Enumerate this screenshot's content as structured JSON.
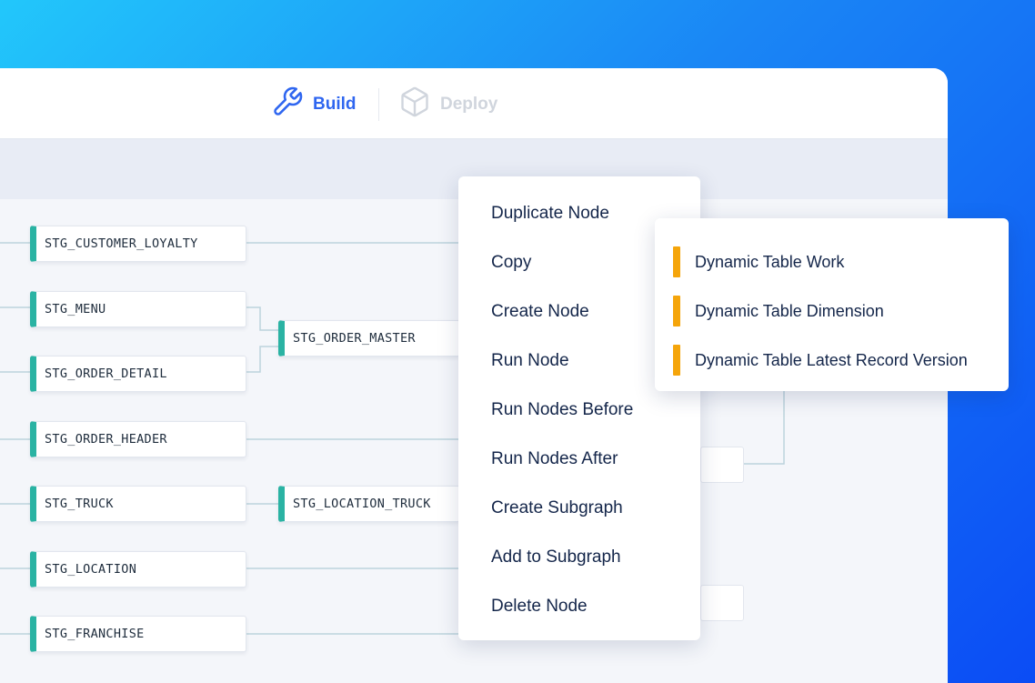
{
  "tabs": {
    "build": {
      "label": "Build",
      "icon": "wrench-icon",
      "color": "#2f66f0"
    },
    "deploy": {
      "label": "Deploy",
      "icon": "cube-icon",
      "color": "#d0d5dd"
    }
  },
  "nodes": [
    {
      "label": "STG_CUSTOMER_LOYALTY"
    },
    {
      "label": "STG_MENU"
    },
    {
      "label": "STG_ORDER_DETAIL"
    },
    {
      "label": "STG_ORDER_HEADER"
    },
    {
      "label": "STG_TRUCK"
    },
    {
      "label": "STG_LOCATION"
    },
    {
      "label": "STG_FRANCHISE"
    },
    {
      "label": "STG_ORDER_MASTER"
    },
    {
      "label": "STG_LOCATION_TRUCK"
    }
  ],
  "context_menu": {
    "items": [
      {
        "label": "Duplicate Node"
      },
      {
        "label": "Copy"
      },
      {
        "label": "Create Node"
      },
      {
        "label": "Run Node"
      },
      {
        "label": "Run Nodes Before"
      },
      {
        "label": "Run Nodes After"
      },
      {
        "label": "Create Subgraph"
      },
      {
        "label": "Add to Subgraph"
      },
      {
        "label": "Delete Node"
      }
    ]
  },
  "submenu": {
    "accent": "#f5a50b",
    "items": [
      {
        "label": "Dynamic Table Work"
      },
      {
        "label": "Dynamic Table Dimension"
      },
      {
        "label": "Dynamic Table Latest Record Version"
      }
    ]
  },
  "node_accent": "#2ab3a3"
}
